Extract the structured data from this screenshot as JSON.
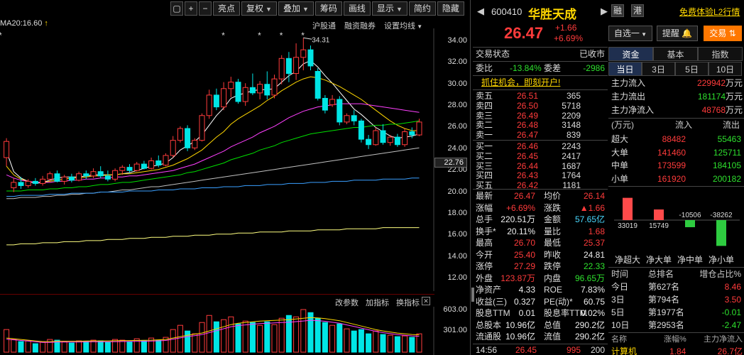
{
  "toolbar": {
    "buttons": [
      "亮点",
      "复权",
      "叠加",
      "筹码",
      "画线",
      "显示",
      "简约",
      "隐藏"
    ],
    "has_caret": [
      false,
      true,
      true,
      false,
      false,
      true,
      false,
      false
    ]
  },
  "ma_legend": "MA20:16.60",
  "chart_links": [
    "沪股通",
    "融资融券",
    "设置均线"
  ],
  "indicator_links": [
    "改参数",
    "加指标",
    "换指标"
  ],
  "price_axis": [
    "34.00",
    "32.00",
    "30.00",
    "28.00",
    "26.00",
    "24.00",
    "22.00",
    "20.00",
    "18.00",
    "16.00",
    "14.00",
    "12.00"
  ],
  "current_price_tag": "22.76",
  "high_marker": "34.31",
  "volume_axis": [
    "603.00",
    "301.00"
  ],
  "chart_data": {
    "type": "candlestick",
    "ylim": [
      12,
      34
    ],
    "candles": [
      {
        "o": 23.2,
        "h": 25.0,
        "l": 22.4,
        "c": 24.7
      },
      {
        "o": 20.4,
        "h": 21.3,
        "l": 20.0,
        "c": 20.9
      },
      {
        "o": 20.9,
        "h": 21.4,
        "l": 20.3,
        "c": 20.6
      },
      {
        "o": 20.6,
        "h": 21.2,
        "l": 20.4,
        "c": 21.0
      },
      {
        "o": 21.0,
        "h": 21.3,
        "l": 20.6,
        "c": 20.8
      },
      {
        "o": 20.8,
        "h": 21.5,
        "l": 20.6,
        "c": 21.2
      },
      {
        "o": 21.2,
        "h": 21.9,
        "l": 20.9,
        "c": 21.7
      },
      {
        "o": 21.7,
        "h": 22.0,
        "l": 20.9,
        "c": 21.0
      },
      {
        "o": 21.0,
        "h": 21.6,
        "l": 20.7,
        "c": 21.4
      },
      {
        "o": 21.4,
        "h": 21.7,
        "l": 20.9,
        "c": 21.1
      },
      {
        "o": 21.1,
        "h": 21.9,
        "l": 21.0,
        "c": 21.7
      },
      {
        "o": 21.7,
        "h": 22.0,
        "l": 21.2,
        "c": 21.5
      },
      {
        "o": 21.5,
        "h": 22.2,
        "l": 21.3,
        "c": 21.9
      },
      {
        "o": 21.9,
        "h": 22.4,
        "l": 21.3,
        "c": 21.5
      },
      {
        "o": 21.5,
        "h": 22.0,
        "l": 21.0,
        "c": 21.2
      },
      {
        "o": 21.2,
        "h": 22.2,
        "l": 21.0,
        "c": 22.0
      },
      {
        "o": 22.0,
        "h": 22.5,
        "l": 21.6,
        "c": 22.3
      },
      {
        "o": 22.3,
        "h": 22.6,
        "l": 21.8,
        "c": 22.0
      },
      {
        "o": 22.0,
        "h": 22.8,
        "l": 21.9,
        "c": 22.6
      },
      {
        "o": 22.6,
        "h": 22.9,
        "l": 22.1,
        "c": 22.2
      },
      {
        "o": 22.2,
        "h": 23.2,
        "l": 22.1,
        "c": 22.9
      },
      {
        "o": 22.9,
        "h": 23.4,
        "l": 22.3,
        "c": 22.5
      },
      {
        "o": 22.5,
        "h": 23.6,
        "l": 22.4,
        "c": 23.4
      },
      {
        "o": 23.4,
        "h": 25.2,
        "l": 23.2,
        "c": 24.8
      },
      {
        "o": 24.8,
        "h": 26.1,
        "l": 24.6,
        "c": 25.9
      },
      {
        "o": 25.9,
        "h": 26.2,
        "l": 23.8,
        "c": 24.1
      },
      {
        "o": 24.1,
        "h": 25.0,
        "l": 23.9,
        "c": 24.8
      },
      {
        "o": 24.8,
        "h": 27.3,
        "l": 24.7,
        "c": 27.1
      },
      {
        "o": 27.1,
        "h": 29.5,
        "l": 26.8,
        "c": 29.0
      },
      {
        "o": 29.0,
        "h": 29.6,
        "l": 27.6,
        "c": 27.9
      },
      {
        "o": 27.9,
        "h": 30.2,
        "l": 27.6,
        "c": 29.6
      },
      {
        "o": 29.6,
        "h": 30.7,
        "l": 28.8,
        "c": 30.2
      },
      {
        "o": 30.2,
        "h": 30.5,
        "l": 28.2,
        "c": 28.4
      },
      {
        "o": 28.4,
        "h": 30.1,
        "l": 28.0,
        "c": 29.7
      },
      {
        "o": 29.7,
        "h": 31.0,
        "l": 29.0,
        "c": 29.2
      },
      {
        "o": 29.2,
        "h": 30.3,
        "l": 28.6,
        "c": 30.0
      },
      {
        "o": 30.0,
        "h": 31.2,
        "l": 28.6,
        "c": 29.0
      },
      {
        "o": 29.0,
        "h": 30.9,
        "l": 28.7,
        "c": 30.5
      },
      {
        "o": 30.5,
        "h": 32.7,
        "l": 30.0,
        "c": 32.4
      },
      {
        "o": 32.4,
        "h": 33.0,
        "l": 30.2,
        "c": 31.0
      },
      {
        "o": 31.0,
        "h": 33.8,
        "l": 30.4,
        "c": 32.5
      },
      {
        "o": 32.5,
        "h": 34.31,
        "l": 31.3,
        "c": 33.2
      },
      {
        "o": 33.2,
        "h": 33.6,
        "l": 31.3,
        "c": 31.7
      },
      {
        "o": 31.2,
        "h": 31.5,
        "l": 28.5,
        "c": 28.7
      },
      {
        "o": 28.7,
        "h": 29.0,
        "l": 27.3,
        "c": 27.6
      },
      {
        "o": 28.1,
        "h": 29.0,
        "l": 27.9,
        "c": 28.6
      },
      {
        "o": 28.6,
        "h": 28.9,
        "l": 26.2,
        "c": 26.5
      },
      {
        "o": 26.5,
        "h": 27.3,
        "l": 26.3,
        "c": 27.1
      },
      {
        "o": 27.1,
        "h": 27.6,
        "l": 26.2,
        "c": 26.6
      },
      {
        "o": 26.6,
        "h": 26.8,
        "l": 24.6,
        "c": 24.9
      },
      {
        "o": 24.9,
        "h": 25.3,
        "l": 24.0,
        "c": 24.4
      },
      {
        "o": 24.4,
        "h": 26.0,
        "l": 24.3,
        "c": 25.7
      },
      {
        "o": 25.7,
        "h": 26.3,
        "l": 24.4,
        "c": 24.6
      },
      {
        "o": 24.6,
        "h": 25.3,
        "l": 24.3,
        "c": 25.1
      },
      {
        "o": 25.1,
        "h": 25.4,
        "l": 24.2,
        "c": 24.4
      },
      {
        "o": 24.4,
        "h": 25.9,
        "l": 24.2,
        "c": 25.6
      },
      {
        "o": 25.6,
        "h": 26.0,
        "l": 25.0,
        "c": 25.3
      },
      {
        "o": 25.3,
        "h": 26.8,
        "l": 25.2,
        "c": 26.5
      }
    ],
    "ma_lines": [
      {
        "name": "MA5",
        "color": "#ffffff",
        "values": [
          23.8,
          21.9,
          21.3,
          21.0,
          20.8,
          20.9,
          21.1,
          21.3,
          21.4,
          21.4,
          21.4,
          21.5,
          21.6,
          21.6,
          21.6,
          21.6,
          21.7,
          21.8,
          22.0,
          22.2,
          22.4,
          22.5,
          22.7,
          23.2,
          23.9,
          24.3,
          24.7,
          25.3,
          26.2,
          27.1,
          27.8,
          28.7,
          29.0,
          29.2,
          29.4,
          29.5,
          29.5,
          29.6,
          30.2,
          30.8,
          31.2,
          31.9,
          32.2,
          31.6,
          30.8,
          30.1,
          29.3,
          28.5,
          27.7,
          27.2,
          26.6,
          26.0,
          25.6,
          25.2,
          25.0,
          25.1,
          25.2,
          25.4
        ]
      },
      {
        "name": "MA10",
        "color": "#ffd700",
        "values": [
          22.4,
          21.6,
          21.2,
          21.0,
          20.9,
          20.9,
          21.0,
          21.1,
          21.2,
          21.3,
          21.3,
          21.4,
          21.5,
          21.5,
          21.6,
          21.6,
          21.7,
          21.7,
          21.8,
          21.9,
          22.0,
          22.1,
          22.3,
          22.5,
          22.8,
          23.1,
          23.5,
          23.9,
          24.5,
          25.1,
          25.6,
          26.3,
          26.8,
          27.2,
          27.6,
          28.0,
          28.5,
          28.9,
          29.4,
          29.8,
          30.2,
          30.5,
          30.7,
          30.6,
          30.4,
          30.1,
          29.8,
          29.4,
          29.0,
          28.6,
          28.1,
          27.6,
          27.1,
          26.6,
          26.2,
          25.9,
          25.7,
          25.7
        ]
      },
      {
        "name": "MA20",
        "color": "#ff40ff",
        "values": [
          21.6,
          21.3,
          21.1,
          21.0,
          20.9,
          20.9,
          20.9,
          21.0,
          21.0,
          21.1,
          21.1,
          21.2,
          21.2,
          21.3,
          21.3,
          21.4,
          21.4,
          21.5,
          21.5,
          21.6,
          21.7,
          21.8,
          21.9,
          22.0,
          22.2,
          22.4,
          22.6,
          22.9,
          23.2,
          23.5,
          23.8,
          24.2,
          24.5,
          24.8,
          25.1,
          25.5,
          25.8,
          26.1,
          26.5,
          26.9,
          27.2,
          27.5,
          27.7,
          27.9,
          28.0,
          28.1,
          28.2,
          28.2,
          28.2,
          28.2,
          28.1,
          28.0,
          27.9,
          27.8,
          27.7,
          27.6,
          27.5,
          27.4
        ]
      },
      {
        "name": "MA30",
        "color": "#00e000",
        "values": [
          20.1,
          20.1,
          20.1,
          20.2,
          20.2,
          20.2,
          20.3,
          20.3,
          20.4,
          20.4,
          20.5,
          20.5,
          20.6,
          20.7,
          20.7,
          20.8,
          20.9,
          20.9,
          21.0,
          21.1,
          21.2,
          21.3,
          21.4,
          21.5,
          21.6,
          21.8,
          21.9,
          22.1,
          22.3,
          22.5,
          22.7,
          23.0,
          23.2,
          23.4,
          23.6,
          23.9,
          24.1,
          24.3,
          24.6,
          24.8,
          25.0,
          25.2,
          25.4,
          25.5,
          25.6,
          25.7,
          25.8,
          25.9,
          26.0,
          26.0,
          26.1,
          26.2,
          26.2,
          26.3,
          26.3,
          26.4,
          26.5,
          26.6
        ]
      },
      {
        "name": "MA60",
        "color": "#c0c0c0",
        "values": [
          19.4,
          19.4,
          19.5,
          19.5,
          19.5,
          19.6,
          19.6,
          19.7,
          19.7,
          19.8,
          19.8,
          19.9,
          19.9,
          20.0,
          20.0,
          20.1,
          20.2,
          20.2,
          20.3,
          20.4,
          20.5,
          20.5,
          20.6,
          20.7,
          20.8,
          20.9,
          21.0,
          21.1,
          21.2,
          21.3,
          21.4,
          21.5,
          21.6,
          21.7,
          21.8,
          21.9,
          22.0,
          22.1,
          22.2,
          22.3,
          22.4,
          22.5,
          22.6,
          22.7,
          22.8,
          22.9,
          23.0,
          23.1,
          23.2,
          23.3,
          23.4,
          23.5,
          23.6,
          23.7,
          23.8,
          23.9,
          24.0,
          24.1
        ]
      },
      {
        "name": "MA120",
        "color": "#3aa0ff",
        "values": [
          19.6,
          19.6,
          19.7,
          19.7,
          19.7,
          19.7,
          19.8,
          19.8,
          19.8,
          19.9,
          19.9,
          19.9,
          19.9,
          20.0,
          20.0,
          20.0,
          20.0,
          20.1,
          20.1,
          20.1,
          20.1,
          20.2,
          20.2,
          20.2,
          20.3,
          20.3,
          20.3,
          20.4,
          20.4,
          20.4,
          20.5,
          20.5,
          20.5,
          20.6,
          20.6,
          20.6,
          20.7,
          20.7,
          20.7,
          20.8,
          20.8,
          20.8,
          20.9,
          20.9,
          20.9,
          21.0,
          21.0,
          21.0,
          21.1,
          21.1,
          21.1,
          21.1,
          21.2,
          21.2,
          21.2,
          21.2,
          21.3,
          21.3
        ]
      },
      {
        "name": "MA250",
        "color": "#ffff80",
        "values": [
          15.1,
          15.1,
          15.2,
          15.2,
          15.2,
          15.3,
          15.3,
          15.3,
          15.4,
          15.4,
          15.4,
          15.5,
          15.5,
          15.5,
          15.6,
          15.6,
          15.6,
          15.7,
          15.7,
          15.7,
          15.8,
          15.8,
          15.8,
          15.9,
          15.9,
          15.9,
          16.0,
          16.0,
          16.0,
          16.1,
          16.1,
          16.1,
          16.2,
          16.2,
          16.2,
          16.3,
          16.3,
          16.3,
          16.3,
          16.4,
          16.4,
          16.4,
          16.4,
          16.5,
          16.5,
          16.5,
          16.5,
          16.6,
          16.6,
          16.6,
          16.6,
          16.6,
          16.7,
          16.7,
          16.7,
          16.7,
          16.7,
          16.7
        ]
      }
    ],
    "volume": [
      320,
      180,
      150,
      160,
      120,
      140,
      180,
      170,
      150,
      130,
      160,
      150,
      170,
      160,
      140,
      180,
      170,
      150,
      190,
      160,
      200,
      170,
      210,
      320,
      380,
      300,
      260,
      420,
      520,
      430,
      460,
      500,
      400,
      440,
      420,
      380,
      430,
      390,
      480,
      520,
      500,
      603,
      560,
      480,
      420,
      380,
      400,
      330,
      300,
      320,
      260,
      300,
      250,
      240,
      220,
      230,
      210,
      260
    ],
    "vol_ma": [
      200,
      190,
      180,
      170,
      160,
      150,
      150,
      155,
      155,
      155,
      155,
      158,
      160,
      160,
      160,
      162,
      164,
      165,
      166,
      168,
      170,
      175,
      180,
      200,
      220,
      240,
      255,
      270,
      300,
      330,
      360,
      390,
      410,
      420,
      430,
      440,
      445,
      450,
      455,
      460,
      470,
      480,
      490,
      485,
      475,
      460,
      445,
      420,
      395,
      370,
      345,
      320,
      300,
      285,
      270,
      260,
      250,
      245
    ],
    "star_candle_index": [
      30,
      35,
      38,
      41
    ]
  },
  "stock": {
    "code": "600410",
    "name": "华胜天成",
    "price": "26.47",
    "change": "+1.66",
    "pct": "+6.69%",
    "tag1": "融",
    "tag2": "港",
    "l2_link": "免费体验L2行情",
    "watch_btn": "自选一",
    "alert_btn": "提醒",
    "trade_btn": "交易"
  },
  "status": {
    "label": "交易状态",
    "value": "已收市"
  },
  "ratio": {
    "l1": "委比",
    "v1": "-13.84%",
    "l2": "委差",
    "v2": "-2986"
  },
  "promo": "抓住机会，即刻开户!",
  "asks": [
    {
      "label": "卖五",
      "price": "26.51",
      "vol": "365"
    },
    {
      "label": "卖四",
      "price": "26.50",
      "vol": "5718"
    },
    {
      "label": "卖三",
      "price": "26.49",
      "vol": "2209"
    },
    {
      "label": "卖二",
      "price": "26.48",
      "vol": "3148"
    },
    {
      "label": "卖一",
      "price": "26.47",
      "vol": "839"
    }
  ],
  "bids": [
    {
      "label": "买一",
      "price": "26.46",
      "vol": "2243"
    },
    {
      "label": "买二",
      "price": "26.45",
      "vol": "2417"
    },
    {
      "label": "买三",
      "price": "26.44",
      "vol": "1687"
    },
    {
      "label": "买四",
      "price": "26.43",
      "vol": "1764"
    },
    {
      "label": "买五",
      "price": "26.42",
      "vol": "1181"
    }
  ],
  "stats": [
    {
      "l1": "最新",
      "v1": "26.47",
      "c1": "red",
      "l2": "均价",
      "v2": "26.14",
      "c2": "red"
    },
    {
      "l1": "涨幅",
      "v1": "+6.69%",
      "c1": "red",
      "l2": "涨跌",
      "v2": "▲1.66",
      "c2": "red"
    },
    {
      "l1": "总手",
      "v1": "220.51万",
      "c1": "wht",
      "l2": "金额",
      "v2": "57.65亿",
      "c2": "cyn"
    },
    {
      "l1": "换手*",
      "v1": "20.11%",
      "c1": "wht",
      "l2": "量比",
      "v2": "1.68",
      "c2": "red"
    },
    {
      "l1": "最高",
      "v1": "26.70",
      "c1": "red",
      "l2": "最低",
      "v2": "25.37",
      "c2": "red"
    },
    {
      "l1": "今开",
      "v1": "25.40",
      "c1": "red",
      "l2": "昨收",
      "v2": "24.81",
      "c2": "wht"
    },
    {
      "l1": "涨停",
      "v1": "27.29",
      "c1": "red",
      "l2": "跌停",
      "v2": "22.33",
      "c2": "grn"
    },
    {
      "l1": "外盘",
      "v1": "123.87万",
      "c1": "red",
      "l2": "内盘",
      "v2": "96.65万",
      "c2": "grn"
    },
    {
      "l1": "净资产",
      "v1": "4.33",
      "c1": "wht",
      "l2": "ROE",
      "v2": "7.83%",
      "c2": "wht"
    },
    {
      "l1": "收益(三)",
      "v1": "0.327",
      "c1": "wht",
      "l2": "PE(动)*",
      "v2": "60.75",
      "c2": "wht"
    },
    {
      "l1": "股息TTM",
      "v1": "0.01",
      "c1": "wht",
      "l2": "股息率TTM",
      "v2": "0.02%",
      "c2": "wht"
    },
    {
      "l1": "总股本",
      "v1": "10.96亿",
      "c1": "wht",
      "l2": "总值",
      "v2": "290.2亿",
      "c2": "wht"
    },
    {
      "l1": "流通股",
      "v1": "10.96亿",
      "c1": "wht",
      "l2": "流值",
      "v2": "290.2亿",
      "c2": "wht"
    }
  ],
  "tick": {
    "time": "14:56",
    "price": "26.45",
    "vol": "995",
    "num": "200"
  },
  "right": {
    "tabs": [
      "资金",
      "基本",
      "指数"
    ],
    "subtabs": [
      "当日",
      "3日",
      "5日",
      "10日"
    ],
    "flow": [
      {
        "label": "主力流入",
        "value": "229942",
        "unit": "万元",
        "color": "red"
      },
      {
        "label": "主力流出",
        "value": "181174",
        "unit": "万元",
        "color": "grn"
      },
      {
        "label": "主力净流入",
        "value": "48768",
        "unit": "万元",
        "color": "red"
      }
    ],
    "table_head": [
      "(万元)",
      "流入",
      "流出"
    ],
    "table": [
      {
        "label": "超大",
        "in": "88482",
        "out": "55463"
      },
      {
        "label": "大单",
        "in": "141460",
        "out": "125711"
      },
      {
        "label": "中单",
        "in": "173599",
        "out": "184105"
      },
      {
        "label": "小单",
        "in": "161920",
        "out": "200182"
      }
    ],
    "net_bars": {
      "labels": [
        "净超大",
        "净大单",
        "净中单",
        "净小单"
      ],
      "values": [
        33019,
        15749,
        -10506,
        -38262
      ],
      "value_labels": [
        "33019",
        "15749",
        "-10506",
        "-38262"
      ]
    },
    "rank_head": [
      "时间",
      "总排名",
      "增仓占比%"
    ],
    "rank": [
      {
        "t": "今日",
        "r": "第627名",
        "v": "8.46",
        "c": "red"
      },
      {
        "t": "3日",
        "r": "第794名",
        "v": "3.50",
        "c": "red"
      },
      {
        "t": "5日",
        "r": "第1977名",
        "v": "-0.01",
        "c": "grn"
      },
      {
        "t": "10日",
        "r": "第2953名",
        "v": "-2.47",
        "c": "grn"
      }
    ],
    "sector_head": [
      "名称",
      "涨幅%",
      "主力净流入"
    ],
    "sector_row": {
      "name": "计算机",
      "pct": "1.84",
      "flow": "26.7亿"
    }
  }
}
